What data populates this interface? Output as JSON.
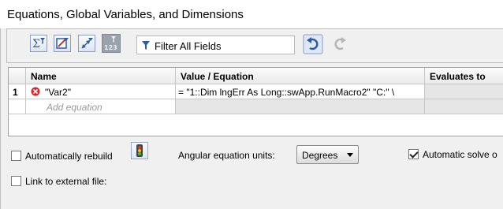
{
  "window": {
    "title": "Equations, Global Variables, and Dimensions"
  },
  "toolbar": {
    "buttons": [
      {
        "name": "equation-view-icon"
      },
      {
        "name": "sketch-equation-view-icon"
      },
      {
        "name": "dimension-view-icon"
      },
      {
        "name": "ordered-view-icon"
      }
    ],
    "filter_placeholder": "Filter All Fields",
    "undo": "undo-icon",
    "redo": "redo-icon"
  },
  "table": {
    "columns": [
      "Name",
      "Value / Equation",
      "Evaluates to"
    ],
    "rows": [
      {
        "index": "1",
        "name": "\"Var2\"",
        "value": "= \"1::Dim lngErr As Long::swApp.RunMacro2\" \"C:\" \\",
        "evaluates": ""
      }
    ],
    "add_row_placeholder": "Add equation"
  },
  "options": {
    "auto_rebuild": {
      "label": "Automatically rebuild",
      "checked": false
    },
    "angular_units": {
      "label": "Angular equation units:",
      "value": "Degrees"
    },
    "auto_solve": {
      "label": "Automatic solve o",
      "checked": true
    },
    "link_external": {
      "label": "Link to external file:",
      "checked": false
    }
  },
  "colors": {
    "error": "#d9262b",
    "accent": "#2f5aa8"
  }
}
